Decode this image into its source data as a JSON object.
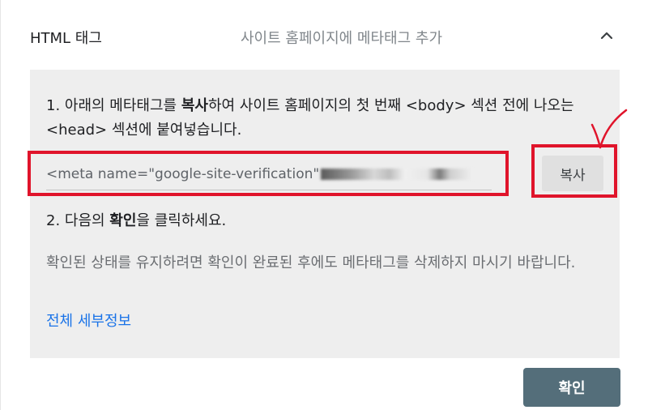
{
  "header": {
    "title": "HTML 태그",
    "subtitle": "사이트 홈페이지에 메타태그 추가",
    "collapse_icon": "chevron-up-icon"
  },
  "step1": {
    "prefix": "1. 아래의 메타태그를 ",
    "bold": "복사",
    "suffix": "하여 사이트 홈페이지의 첫 번째 <body> 섹션 전에 나오는 <head> 섹션에 붙여넣습니다."
  },
  "meta_tag": {
    "visible_text": "<meta name=\"google-site-verification\""
  },
  "copy_button": {
    "label": "복사"
  },
  "step2": {
    "prefix": "2. 다음의 ",
    "bold": "확인",
    "suffix": "을 클릭하세요."
  },
  "note": "확인된 상태를 유지하려면 확인이 완료된 후에도 메타태그를 삭제하지 마시기 바랍니다.",
  "details_link": "전체 세부정보",
  "confirm_button": {
    "label": "확인"
  },
  "colors": {
    "accent_link": "#1a73e8",
    "confirm_bg": "#546e7a",
    "panel_bg": "#eeeeee",
    "annotation_red": "#e0142b"
  }
}
